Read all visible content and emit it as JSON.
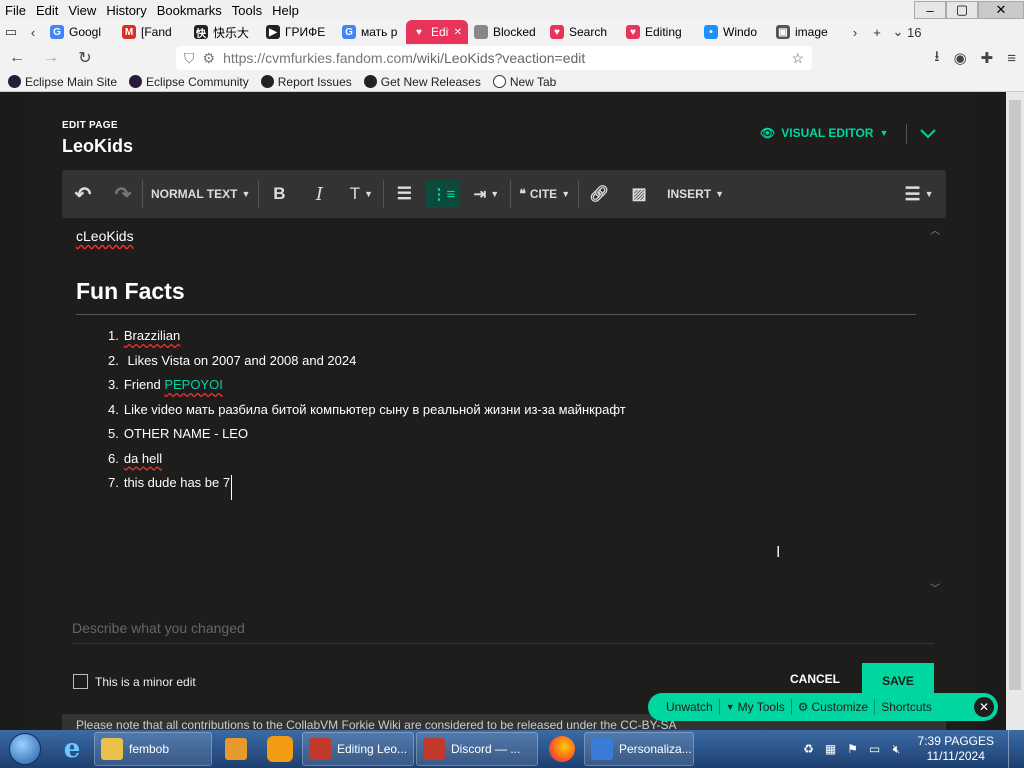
{
  "menubar": {
    "items": [
      "File",
      "Edit",
      "View",
      "History",
      "Bookmarks",
      "Tools",
      "Help"
    ],
    "window_controls": [
      "–",
      "▢",
      "✕"
    ]
  },
  "tabs": [
    {
      "label": "Googl",
      "color": "#4285f4",
      "glyph": "G"
    },
    {
      "label": "[Fand",
      "color": "#d93025",
      "glyph": "M"
    },
    {
      "label": "快乐大",
      "color": "#222222",
      "glyph": "快"
    },
    {
      "label": "ГРИФЕ",
      "color": "#222222",
      "glyph": "▶"
    },
    {
      "label": "мать р",
      "color": "#4285f4",
      "glyph": "G"
    },
    {
      "label": "Edit",
      "color": "#e8345a",
      "glyph": "♥"
    },
    {
      "label": "Blocked by",
      "color": "#888888",
      "glyph": ""
    },
    {
      "label": "Search",
      "color": "#e8345a",
      "glyph": "♥"
    },
    {
      "label": "Editing",
      "color": "#e8345a",
      "glyph": "♥"
    },
    {
      "label": "Windo",
      "color": "#1e90ff",
      "glyph": "•"
    },
    {
      "label": "image",
      "color": "#555555",
      "glyph": "▣"
    }
  ],
  "tab_count": "16",
  "address": {
    "url_host": "https://cvmfurkies.fandom.com",
    "url_path": "/wiki/LeoKids?veaction=edit"
  },
  "bookmarks": [
    {
      "label": "Eclipse Main Site",
      "icon": "eclipse-icon"
    },
    {
      "label": "Eclipse Community",
      "icon": "eclipse-icon"
    },
    {
      "label": "Report Issues",
      "icon": "github-icon"
    },
    {
      "label": "Get New Releases",
      "icon": "github-icon"
    },
    {
      "label": "New Tab",
      "icon": "globe-icon"
    }
  ],
  "editor": {
    "edit_label": "EDIT PAGE",
    "page_title": "LeoKids",
    "mode_label": "VISUAL EDITOR",
    "accent_color": "#00d6a0",
    "toolbar": {
      "format_label": "NORMAL TEXT",
      "cite_label": "CITE",
      "insert_label": "INSERT"
    },
    "content": {
      "previous_text": "cLeoKids",
      "heading": "Fun Facts",
      "facts": [
        {
          "num": "1.",
          "text": "Brazzilian"
        },
        {
          "num": "2.",
          "text": " Likes Vista on 2007 and 2008 and 2024"
        },
        {
          "num": "3.",
          "text": "Friend ",
          "link": "PEPOYOI"
        },
        {
          "num": "4.",
          "text": "Like video мать разбила битой компьютер сыну в реальной жизни из-за майнкрафт"
        },
        {
          "num": "5.",
          "text": "OTHER NAME - LEO"
        },
        {
          "num": "6.",
          "text": "da hell"
        },
        {
          "num": "7.",
          "text": "this dude has be 7"
        }
      ]
    },
    "summary_placeholder": "Describe what you changed",
    "minor_edit_label": "This is a minor edit",
    "cancel_label": "CANCEL",
    "save_label": "SAVE",
    "notice": "Please note that all contributions to the CollabVM Forkie Wiki are considered to be released under the CC-BY-SA"
  },
  "float_toolbar": {
    "items": [
      "Unwatch",
      "My Tools",
      "Customize",
      "Shortcuts"
    ]
  },
  "taskbar": {
    "items": [
      {
        "label": "fembob",
        "color": "#e8c04a"
      },
      {
        "label": "Editing Leo...",
        "color": "#c0392b"
      },
      {
        "label": "Discord — ...",
        "color": "#c0392b"
      },
      {
        "label": "Personaliza...",
        "color": "#3a7bd5"
      }
    ],
    "clock_time": "7:39 PAGGES",
    "clock_date": "11/11/2024"
  }
}
